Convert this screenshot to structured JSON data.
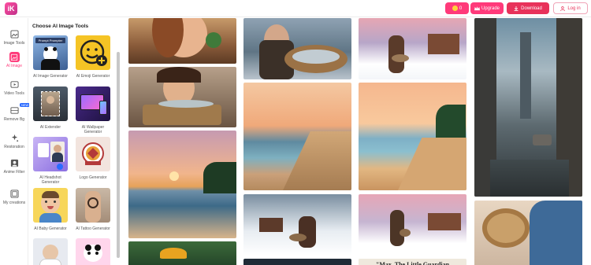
{
  "header": {
    "logo_text": "iK",
    "credits": "0",
    "upgrade_label": "Upgrade",
    "download_label": "Download",
    "login_label": "Log in"
  },
  "nav": {
    "items": [
      {
        "label": "Image Tools",
        "icon": "image-tools-icon"
      },
      {
        "label": "AI Image",
        "icon": "ai-image-icon",
        "active": true
      },
      {
        "label": "Video Tools",
        "icon": "video-tools-icon"
      },
      {
        "label": "Remove Bg",
        "icon": "remove-bg-icon",
        "badge": "NEW"
      },
      {
        "label": "Restoration",
        "icon": "restoration-icon"
      },
      {
        "label": "Anime Filter",
        "icon": "anime-filter-icon"
      },
      {
        "label": "My creations",
        "icon": "my-creations-icon"
      }
    ]
  },
  "panel": {
    "title": "Choose AI Image Tools",
    "tools": [
      {
        "label": "AI Image Generator",
        "thumb_label": "Prompt Prompter"
      },
      {
        "label": "AI Emoji Generator"
      },
      {
        "label": "AI Extender"
      },
      {
        "label": "AI Wallpaper Generator"
      },
      {
        "label": "AI Headshot Generator"
      },
      {
        "label": "Logo Generator"
      },
      {
        "label": "AI Baby Generator"
      },
      {
        "label": "AI Tattoo Generator"
      },
      {
        "label": ""
      },
      {
        "label": ""
      }
    ]
  },
  "gallery": {
    "caption": "\"Max, The Little Guardian"
  },
  "colors": {
    "accent": "#ff3a7a",
    "download": "#e8325a",
    "badge": "#2b6bff"
  }
}
